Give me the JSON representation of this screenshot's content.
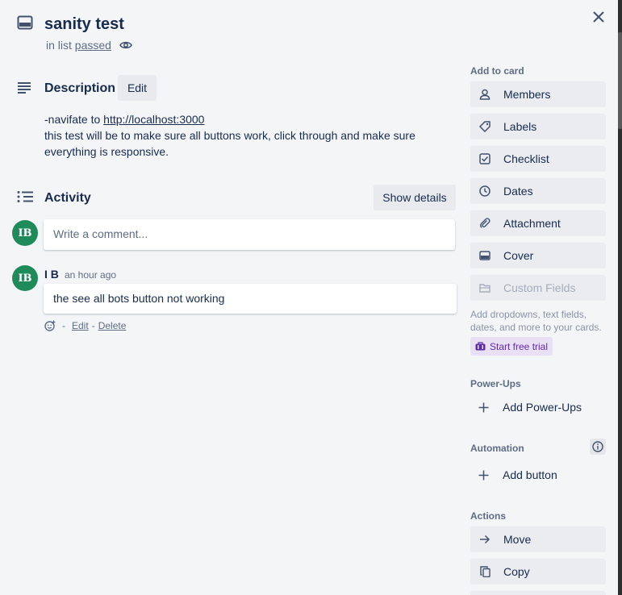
{
  "card": {
    "title": "sanity test",
    "in_list_prefix": "in list",
    "list_name": "passed"
  },
  "description": {
    "heading": "Description",
    "edit_label": "Edit",
    "line1_prefix": "-navifate to ",
    "line1_link": "http://localhost:3000",
    "line2": "this test will be to make sure all buttons work, click through and make sure everything is responsive."
  },
  "activity": {
    "heading": "Activity",
    "show_details_label": "Show details",
    "comment_placeholder": "Write a comment...",
    "avatar_initials": "IB",
    "comments": [
      {
        "author": "I B",
        "avatar_initials": "IB",
        "timestamp": "an hour ago",
        "text": "the see all bots button not working",
        "separator": "-",
        "edit_label": "Edit",
        "delete_label": "Delete"
      }
    ]
  },
  "sidebar": {
    "add_to_card_heading": "Add to card",
    "add_to_card": [
      {
        "label": "Members",
        "icon": "person-icon"
      },
      {
        "label": "Labels",
        "icon": "tag-icon"
      },
      {
        "label": "Checklist",
        "icon": "checkbox-icon"
      },
      {
        "label": "Dates",
        "icon": "clock-icon"
      },
      {
        "label": "Attachment",
        "icon": "paperclip-icon"
      },
      {
        "label": "Cover",
        "icon": "card-cover-icon"
      },
      {
        "label": "Custom Fields",
        "icon": "folder-icon",
        "disabled": true
      }
    ],
    "custom_fields_hint": "Add dropdowns, text fields, dates, and more to your cards.",
    "trial_label": "Start free trial",
    "powerups_heading": "Power-Ups",
    "add_powerups_label": "Add Power-Ups",
    "automation_heading": "Automation",
    "add_button_label": "Add button",
    "actions_heading": "Actions",
    "actions": [
      {
        "label": "Move",
        "icon": "arrow-right-icon"
      },
      {
        "label": "Copy",
        "icon": "copy-icon"
      }
    ]
  },
  "colors": {
    "background": "#f4f5f7",
    "button": "#eaecf0",
    "avatar": "#1f8a5a",
    "trial": "#eae0f5"
  }
}
